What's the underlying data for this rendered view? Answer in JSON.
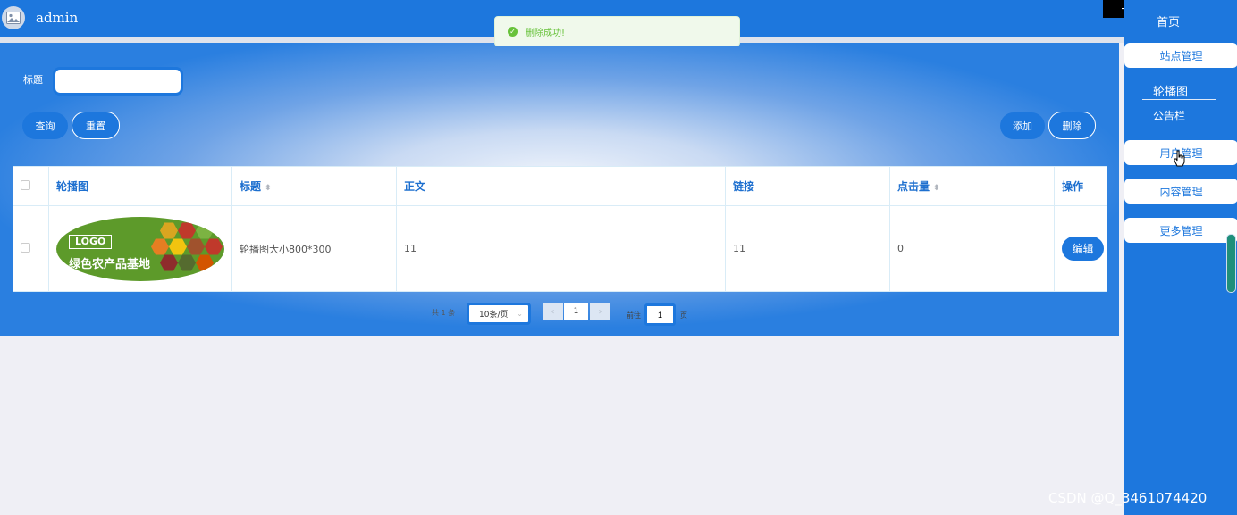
{
  "header": {
    "username": "admin",
    "avatar_icon": "image-icon"
  },
  "window_controls": {
    "minimize": "─",
    "restore": "❐",
    "close": "✕"
  },
  "toast": {
    "message": "删除成功!",
    "icon": "check-circle-icon",
    "color": "#67c23a"
  },
  "search": {
    "label": "标题",
    "value": "",
    "search_button": "查询",
    "reset_button": "重置"
  },
  "actions": {
    "add_button": "添加",
    "delete_button": "删除"
  },
  "table": {
    "columns": [
      "轮播图",
      "标题",
      "正文",
      "链接",
      "点击量",
      "操作"
    ],
    "rows": [
      {
        "banner": {
          "logo": "LOGO",
          "slogan": "绿色农产品基地"
        },
        "title": "轮播图大小800*300",
        "content": "11",
        "link": "11",
        "clicks": "0",
        "edit_button": "编辑"
      }
    ]
  },
  "pagination": {
    "total": "共 1 条",
    "page_size": "10条/页",
    "current_page": "1",
    "goto_label": "前往",
    "goto_value": "1",
    "page_suffix": "页"
  },
  "sidebar": {
    "home": "首页",
    "items": [
      {
        "label": "站点管理"
      },
      {
        "label": "轮播图"
      },
      {
        "label": "公告栏"
      },
      {
        "label": "用户管理"
      },
      {
        "label": "内容管理"
      },
      {
        "label": "更多管理"
      }
    ]
  },
  "watermark": "CSDN @Q_3461074420",
  "colors": {
    "primary": "#1d77dd",
    "background": "#efeff5"
  }
}
